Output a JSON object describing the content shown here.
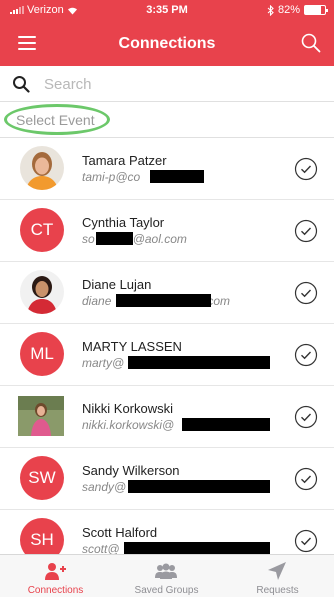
{
  "status_bar": {
    "carrier": "Verizon",
    "time": "3:35 PM",
    "battery_text": "82%",
    "battery_level": 0.82
  },
  "nav": {
    "title": "Connections",
    "menu_icon": "hamburger-menu-icon",
    "search_icon": "search-icon"
  },
  "search": {
    "placeholder": "Search",
    "value": ""
  },
  "event_selector": {
    "label": "Select Event",
    "highlight_color": "#6cc86a"
  },
  "colors": {
    "brand": "#e8424c",
    "tab_inactive": "#8e8e93"
  },
  "connections": [
    {
      "name": "Tamara Patzer",
      "email_visible": "tami-p@co",
      "avatar": "photo",
      "initials": ""
    },
    {
      "name": "Cynthia Taylor",
      "email_visible": "so",
      "email_suffix": "@aol.com",
      "avatar": "initials",
      "initials": "CT"
    },
    {
      "name": "Diane Lujan",
      "email_visible": "diane",
      "email_suffix": "com",
      "avatar": "photo",
      "initials": ""
    },
    {
      "name": "MARTY LASSEN",
      "email_visible": "marty@",
      "avatar": "initials",
      "initials": "ML"
    },
    {
      "name": "Nikki Korkowski",
      "email_visible": "nikki.korkowski@",
      "avatar": "photo",
      "initials": ""
    },
    {
      "name": "Sandy Wilkerson",
      "email_visible": "sandy@",
      "avatar": "initials",
      "initials": "SW"
    },
    {
      "name": "Scott Halford",
      "email_visible": "scott@",
      "avatar": "initials",
      "initials": "SH"
    }
  ],
  "tabs": [
    {
      "label": "Connections",
      "icon": "add-person-icon",
      "active": true
    },
    {
      "label": "Saved Groups",
      "icon": "group-icon",
      "active": false
    },
    {
      "label": "Requests",
      "icon": "send-arrow-icon",
      "active": false
    }
  ]
}
